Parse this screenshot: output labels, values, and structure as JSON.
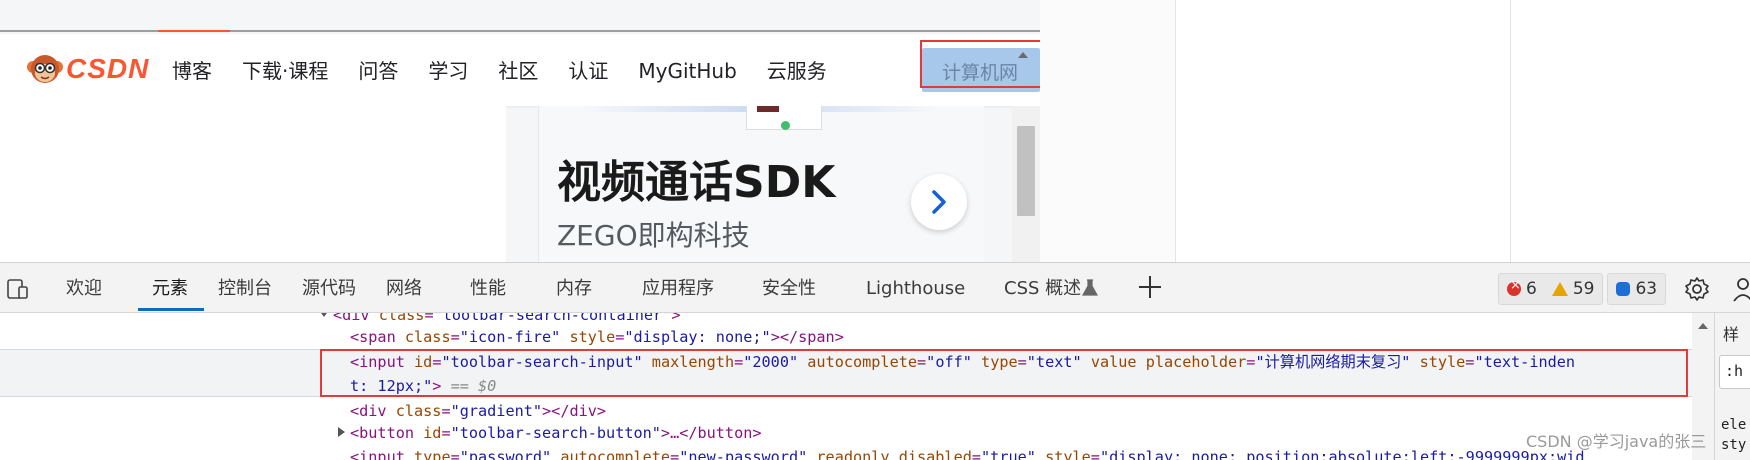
{
  "page": {
    "logo_text": "CSDN",
    "nav_items": [
      "博客",
      "下载·课程",
      "问答",
      "学习",
      "社区",
      "认证",
      "MyGitHub",
      "云服务"
    ],
    "search_placeholder_visible": "计算机网"
  },
  "ad": {
    "title": "视频通话SDK",
    "subtitle": "ZEGO即构科技"
  },
  "devtools": {
    "tabs": [
      "欢迎",
      "元素",
      "控制台",
      "源代码",
      "网络",
      "性能",
      "内存",
      "应用程序",
      "安全性",
      "Lighthouse",
      "CSS 概述"
    ],
    "active_tab": "元素",
    "counts": {
      "errors": "6",
      "warnings": "59",
      "messages": "63"
    }
  },
  "elements": {
    "line0": {
      "pre": "<div ",
      "attr": "class",
      "eq": "=",
      "val": "\"toolbar-search-container\"",
      "post": ">"
    },
    "line1": {
      "open": "<span ",
      "a1": "class",
      "v1": "\"icon-fire\"",
      "a2": "style",
      "v2": "\"display: none;\"",
      "close": "></span>"
    },
    "line2": {
      "open": "<input ",
      "a1": "id",
      "v1": "\"toolbar-search-input\"",
      "a2": "maxlength",
      "v2": "\"2000\"",
      "a3": "autocomplete",
      "v3": "\"off\"",
      "a4": "type",
      "v4": "\"text\"",
      "a5": "value",
      "a6": "placeholder",
      "v6": "\"计算机网络期末复习\"",
      "a7": "style",
      "v7a": "\"text-inden"
    },
    "line3": {
      "v7b": "t: 12px;\"",
      "close": ">",
      "dollar": "== $0"
    },
    "line4": {
      "open": "<div ",
      "a1": "class",
      "v1": "\"gradient\"",
      "close": "></div>"
    },
    "line5": {
      "open": "<button ",
      "a1": "id",
      "v1": "\"toolbar-search-button\"",
      "close": ">…</button>"
    },
    "line6": {
      "open": "<input ",
      "a1": "type",
      "v1": "\"password\"",
      "a2": "autocomplete",
      "v2": "\"new-password\"",
      "a3": "readonly",
      "a4": "disabled",
      "v4": "\"true\"",
      "a5": "style",
      "v5": "\"display: none; position:absolute;left:-9999999px;wid"
    }
  },
  "styles_pane": {
    "tab": "样",
    "filter": ":h",
    "line1": "ele",
    "line2": "sty"
  },
  "watermark": "CSDN @学习java的张三",
  "colors": {
    "csdn_red": "#fc5531",
    "highlight_red": "#e03a3a",
    "active_tab_blue": "#0f6cbd"
  }
}
